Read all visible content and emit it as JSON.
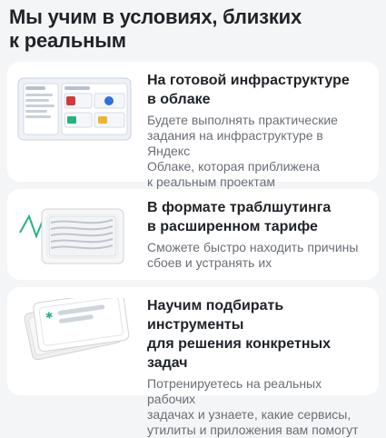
{
  "header": {
    "title": "Мы учим в условиях, близких\nк реальным"
  },
  "cards": [
    {
      "title": "На готовой инфраструктуре\nв облаке",
      "text": "Будете выполнять практические\nзадания на инфраструктуре в Яндекс\nОблаке, которая приближена\nк реальным проектам"
    },
    {
      "title": "В формате траблшутинга\nв расширенном тарифе",
      "text": "Сможете быстро находить причины\nсбоев и устранять их"
    },
    {
      "title": "Научим подбирать инструменты\nдля решения конкретных задач",
      "text": "Потренируетесь на реальных рабочих\nзадачах и узнаете, какие сервисы,\nутилиты и приложения вам помогут"
    }
  ],
  "illustrations": {
    "cloud": "cloud-dashboard-illustration",
    "troubleshooting": "troubleshooting-window-illustration",
    "tools": "tool-cards-illustration",
    "accent_green": "#24b47e",
    "accent_red": "#d33b3b",
    "accent_blue": "#2f6fe4"
  }
}
